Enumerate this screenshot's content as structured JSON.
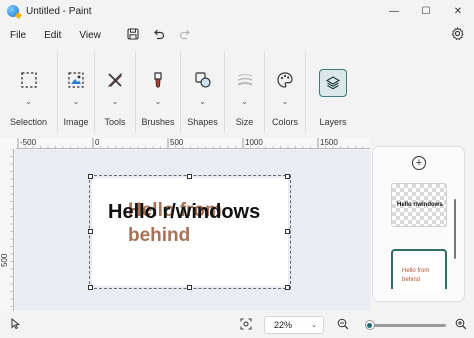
{
  "window": {
    "title": "Untitled - Paint",
    "minimize": "—",
    "maximize": "☐",
    "close": "✕"
  },
  "menu": [
    "File",
    "Edit",
    "View"
  ],
  "ribbon": {
    "groups": [
      {
        "label": "Selection",
        "icon": "selection-icon"
      },
      {
        "label": "Image",
        "icon": "image-icon"
      },
      {
        "label": "Tools",
        "icon": "tools-icon"
      },
      {
        "label": "Brushes",
        "icon": "brush-icon"
      },
      {
        "label": "Shapes",
        "icon": "shapes-icon"
      },
      {
        "label": "Size",
        "icon": "size-icon"
      },
      {
        "label": "Colors",
        "icon": "palette-icon"
      },
      {
        "label": "Layers",
        "icon": "layers-icon"
      }
    ]
  },
  "ruler": {
    "h_labels": [
      "-500",
      "0",
      "500",
      "1000",
      "1500"
    ],
    "v_label": "500"
  },
  "canvas": {
    "ghost_text": "Hello from behind",
    "main_text": "Hello r/windows"
  },
  "layers_panel": {
    "layers": [
      {
        "text": "Hello r/windows",
        "transparent": true
      },
      {
        "text": "Hello from behind",
        "selected": true
      }
    ]
  },
  "status": {
    "zoom": "22%",
    "zoom_fraction": 0.06
  },
  "colors": {
    "accent": "#2f6d6c",
    "ghost_text": "#a87258"
  }
}
